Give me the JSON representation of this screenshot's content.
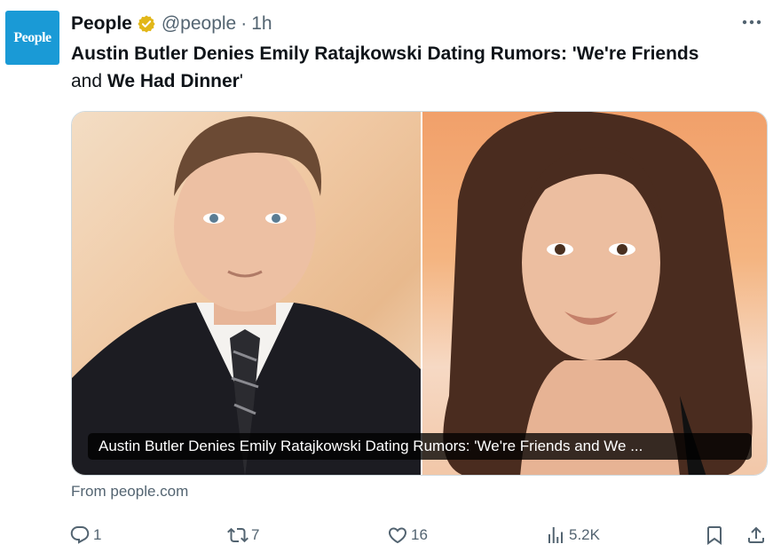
{
  "author": {
    "avatar_text": "People",
    "name": "People",
    "handle": "@people",
    "separator": "·",
    "time": "1h",
    "verified_color": "#e2b719"
  },
  "tweet": {
    "text_part1": "Austin Butler Denies Emily Ratajkowski Dating Rumors: 'We're Friends",
    "text_part2_plain": "and ",
    "text_part2_bold": "We Had Dinner",
    "text_part2_end": "'"
  },
  "card": {
    "caption": "Austin Butler Denies Emily Ratajkowski Dating Rumors: 'We're Friends and We ...",
    "source": "From people.com"
  },
  "actions": {
    "reply_count": "1",
    "retweet_count": "7",
    "like_count": "16",
    "views_count": "5.2K"
  },
  "icons": {
    "more": "more-icon",
    "reply": "reply-icon",
    "retweet": "retweet-icon",
    "like": "heart-icon",
    "views": "views-icon",
    "bookmark": "bookmark-icon",
    "share": "share-icon"
  },
  "colors": {
    "brand_avatar": "#1a9ad6",
    "muted_text": "#536471"
  }
}
